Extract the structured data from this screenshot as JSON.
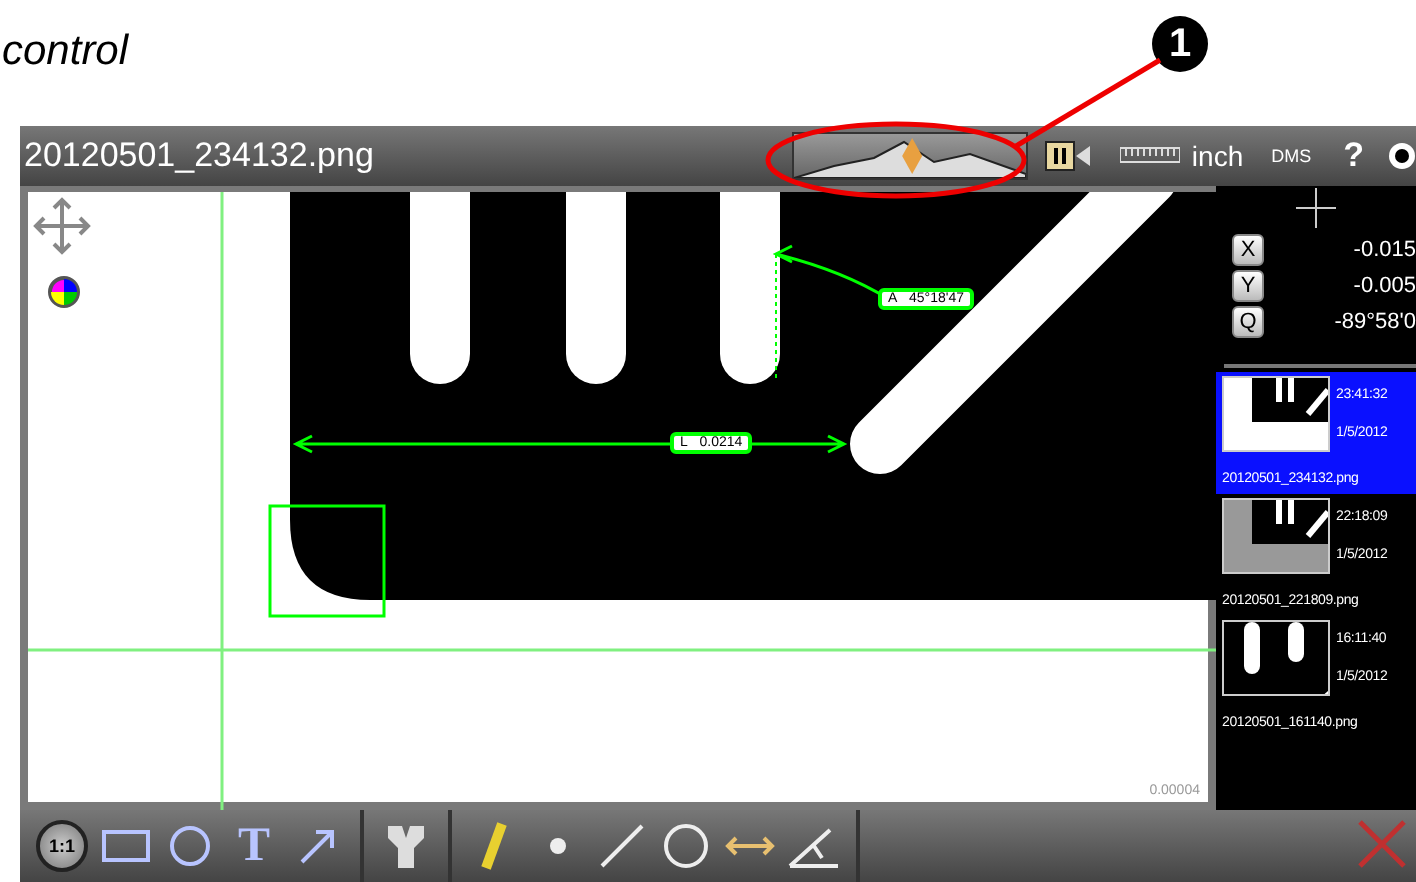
{
  "doc": {
    "heading": "control",
    "callout": "1"
  },
  "window": {
    "title": "20120501_234132.png",
    "slider": {
      "level": 0.51
    },
    "units": "inch",
    "angle_format": "DMS",
    "help": "?"
  },
  "image": {
    "measurements": [
      {
        "kind": "angle",
        "letter": "A",
        "value": "45°18'47"
      },
      {
        "kind": "length",
        "letter": "L",
        "value": "0.0214"
      }
    ],
    "scale_reading": "0.00004"
  },
  "coordinates": [
    {
      "axis": "X",
      "value": "-0.015"
    },
    {
      "axis": "Y",
      "value": "-0.005"
    },
    {
      "axis": "Q",
      "value": "-89°58'0"
    }
  ],
  "captures": [
    {
      "time": "23:41:32",
      "date": "1/5/2012",
      "file": "20120501_234132.png",
      "selected": true
    },
    {
      "time": "22:18:09",
      "date": "1/5/2012",
      "file": "20120501_221809.png",
      "selected": false
    },
    {
      "time": "16:11:40",
      "date": "1/5/2012",
      "file": "20120501_161140.png",
      "selected": false
    }
  ],
  "toolbar": {
    "groups": [
      [
        {
          "kind": "zoom",
          "label": "1:1"
        },
        {
          "kind": "rectangle"
        },
        {
          "kind": "circle-points"
        },
        {
          "kind": "text",
          "label": "T"
        },
        {
          "kind": "arrow"
        }
      ],
      [
        {
          "kind": "filter"
        }
      ],
      [
        {
          "kind": "ruler"
        },
        {
          "kind": "point"
        },
        {
          "kind": "line"
        },
        {
          "kind": "circle"
        },
        {
          "kind": "distance"
        },
        {
          "kind": "angle"
        }
      ]
    ]
  }
}
